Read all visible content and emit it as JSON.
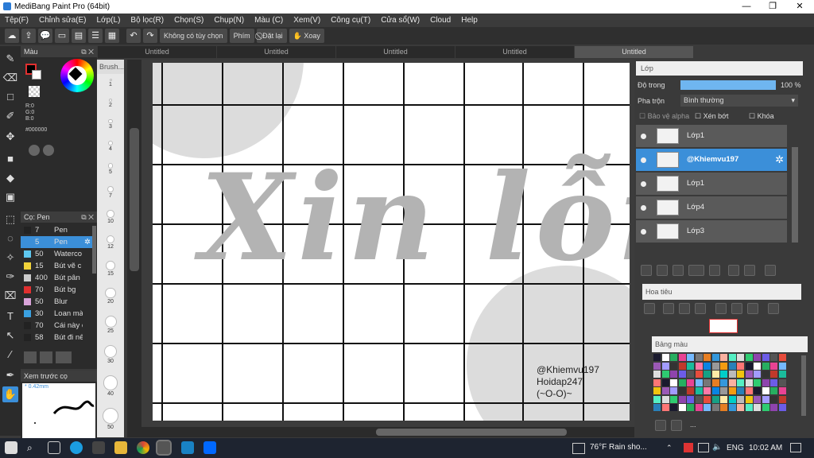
{
  "window": {
    "title": "MediBang Paint Pro (64bit)",
    "min": "—",
    "max": "❐",
    "close": "✕"
  },
  "menu": [
    "Tệp(F)",
    "Chỉnh sửa(E)",
    "Lớp(L)",
    "Bộ lọc(R)",
    "Chọn(S)",
    "Chụp(N)",
    "Màu (C)",
    "Xem(V)",
    "Công cụ(T)",
    "Cửa sổ(W)",
    "Cloud",
    "Help"
  ],
  "toolbar": {
    "option_label": "Không có tùy chọn",
    "key_label": "Phím",
    "reset_label": "Đặt lại",
    "rotate_label": "Xoay"
  },
  "tabs": [
    "Untitled",
    "Untitled",
    "Untitled",
    "Untitled",
    "Untitled"
  ],
  "color_panel": {
    "title": "Màu",
    "r": "R:0",
    "g": "G:0",
    "b": "B:0",
    "hex": "#000000"
  },
  "brush_panel": {
    "title": "Cọ: Pen",
    "items": [
      {
        "size": "7",
        "name": "Pen",
        "color": "#222222"
      },
      {
        "size": "5",
        "name": "Pen",
        "color": "#3b8fd9",
        "selected": true
      },
      {
        "size": "50",
        "name": "Waterco",
        "color": "#5ec8f0"
      },
      {
        "size": "15",
        "name": "Bút vẽ c",
        "color": "#f1d33a"
      },
      {
        "size": "400",
        "name": "Bút pân",
        "color": "#cccccc"
      },
      {
        "size": "70",
        "name": "Bút bg",
        "color": "#e03030"
      },
      {
        "size": "50",
        "name": "Blur",
        "color": "#d9a3d9"
      },
      {
        "size": "30",
        "name": "Loan mà",
        "color": "#3aa0e0"
      },
      {
        "size": "70",
        "name": "Cái này c",
        "color": "#222222"
      },
      {
        "size": "58",
        "name": "Bút đi nê",
        "color": "#222222"
      }
    ]
  },
  "brush_size_panel": {
    "title": "Brush...",
    "sizes": [
      "1",
      "2",
      "3",
      "4",
      "5",
      "7",
      "10",
      "12",
      "15",
      "20",
      "25",
      "30",
      "40",
      "50"
    ]
  },
  "preview_panel": {
    "title": "Xem trước cọ",
    "size": "0.42mm"
  },
  "canvas": {
    "script_text": "Xin lỗi",
    "credit1": "@Khiemvu197",
    "credit2": "Hoidap247",
    "credit3": "(~O-O)~"
  },
  "layer_panel": {
    "title": "Lớp",
    "opacity_label": "Độ trong",
    "opacity": "100 %",
    "opacity_value": 1.0,
    "blend_label": "Pha trộn",
    "blend_value": "Bình thường",
    "protect_alpha": "Bảo vệ alpha",
    "clip": "Xén bớt",
    "lock": "Khóa",
    "layers": [
      {
        "name": "Lớp1"
      },
      {
        "name": "@Khiemvu197",
        "selected": true
      },
      {
        "name": "Lớp1"
      },
      {
        "name": "Lớp4"
      },
      {
        "name": "Lớp3"
      }
    ]
  },
  "navigator": {
    "title": "Hoa tiêu"
  },
  "palette": {
    "title": "Bảng màu",
    "more": "..."
  },
  "taskbar": {
    "weather": "76°F  Rain sho...",
    "lang": "ENG",
    "time": "10:02 AM"
  }
}
